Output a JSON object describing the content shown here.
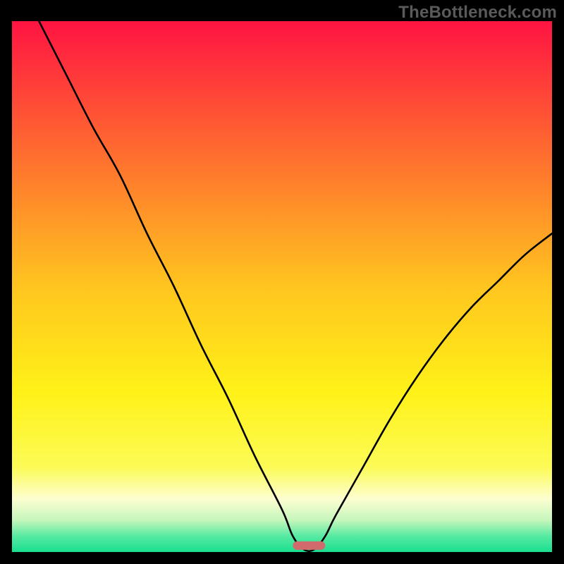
{
  "watermark": "TheBottleneck.com",
  "chart_data": {
    "type": "line",
    "title": "",
    "xlabel": "",
    "ylabel": "",
    "xlim": [
      0,
      100
    ],
    "ylim": [
      0,
      100
    ],
    "x": [
      5,
      10,
      15,
      20,
      25,
      30,
      35,
      40,
      45,
      50,
      52,
      54,
      56,
      58,
      60,
      65,
      70,
      75,
      80,
      85,
      90,
      95,
      100
    ],
    "values": [
      100,
      90,
      80,
      71,
      60,
      50,
      39,
      29,
      18,
      8,
      3,
      0.5,
      0.5,
      3,
      7,
      16,
      25,
      33,
      40,
      46,
      51,
      56,
      60
    ],
    "marker": {
      "x_center": 55,
      "y": 1.2,
      "width": 6,
      "height": 1.6,
      "color": "#d06a6d"
    },
    "background_gradient": {
      "stops": [
        {
          "offset": 0.0,
          "color": "#ff1442"
        },
        {
          "offset": 0.25,
          "color": "#ff6d2f"
        },
        {
          "offset": 0.5,
          "color": "#ffc51f"
        },
        {
          "offset": 0.7,
          "color": "#fff218"
        },
        {
          "offset": 0.84,
          "color": "#fcfb56"
        },
        {
          "offset": 0.9,
          "color": "#fdfed0"
        },
        {
          "offset": 0.94,
          "color": "#c5f6bc"
        },
        {
          "offset": 0.97,
          "color": "#57eaa2"
        },
        {
          "offset": 1.0,
          "color": "#18df8f"
        }
      ]
    }
  }
}
